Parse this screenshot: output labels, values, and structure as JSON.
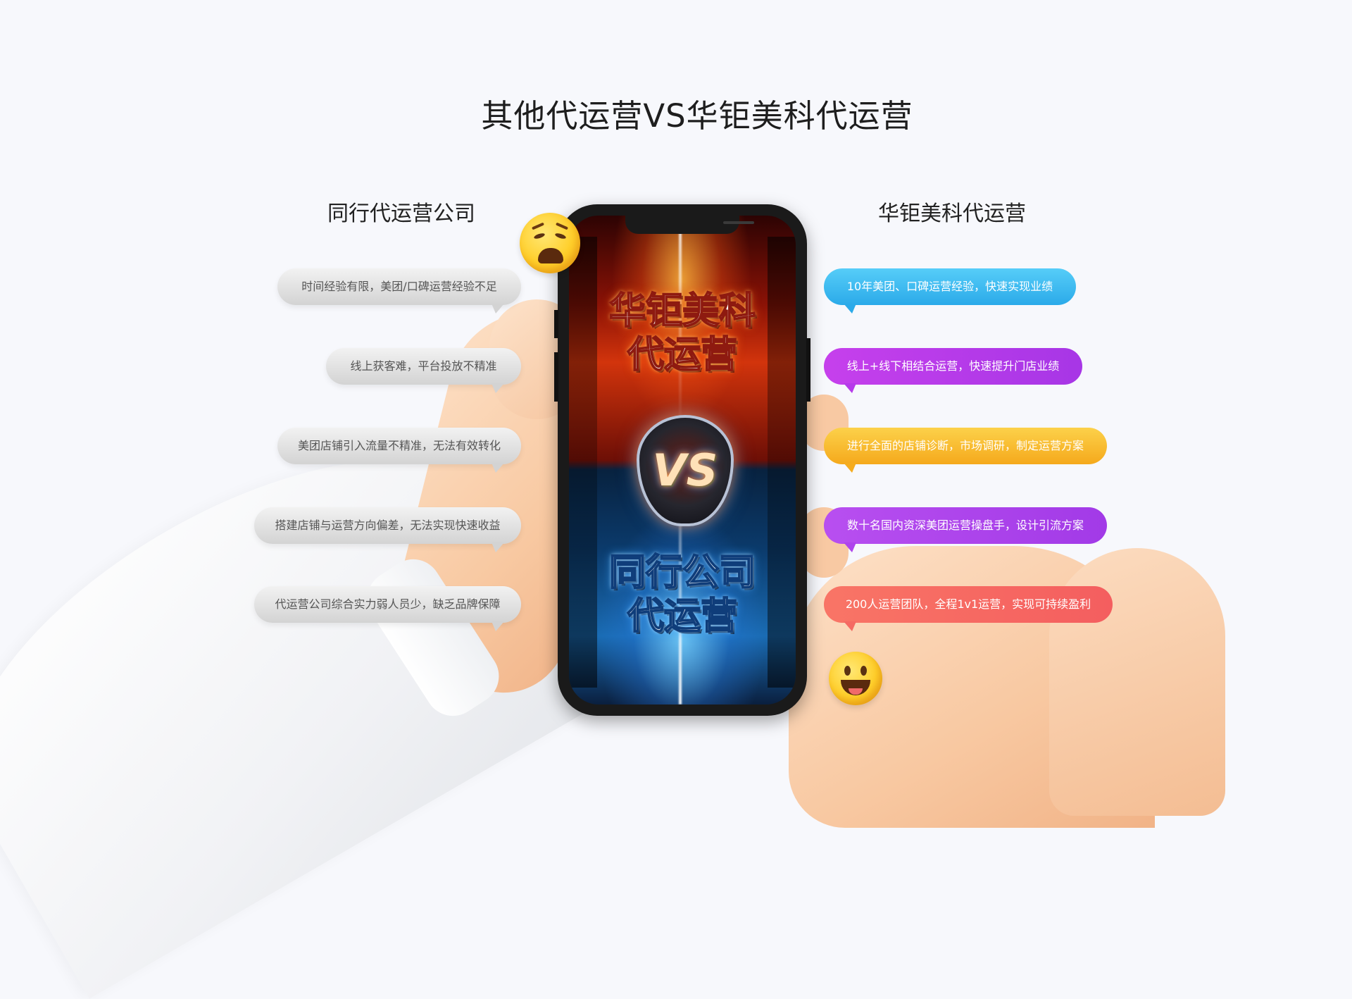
{
  "title": "其他代运营VS华钜美科代运营",
  "left_column": {
    "heading": "同行代运营公司",
    "items": [
      "时间经验有限，美团/口碑运营经验不足",
      "线上获客难，平台投放不精准",
      "美团店铺引入流量不精准，无法有效转化",
      "搭建店铺与运营方向偏差，无法实现快速收益",
      "代运营公司综合实力弱人员少，缺乏品牌保障"
    ]
  },
  "right_column": {
    "heading": "华钜美科代运营",
    "items": [
      "10年美团、口碑运营经验，快速实现业绩",
      "线上+线下相结合运营，快速提升门店业绩",
      "进行全面的店铺诊断，市场调研，制定运营方案",
      "数十名国内资深美团运营操盘手，设计引流方案",
      "200人运营团队，全程1v1运营，实现可持续盈利"
    ],
    "colors": [
      "#2baae9",
      "#b63aea",
      "#f5ac1e",
      "#ae44ec",
      "#f56a63"
    ]
  },
  "phone": {
    "top_line1": "华钜美科",
    "top_line2": "代运营",
    "vs": "VS",
    "bottom_line1": "同行公司",
    "bottom_line2": "代运营"
  },
  "emojis": {
    "left": "sad-face-icon",
    "right": "happy-face-icon"
  }
}
